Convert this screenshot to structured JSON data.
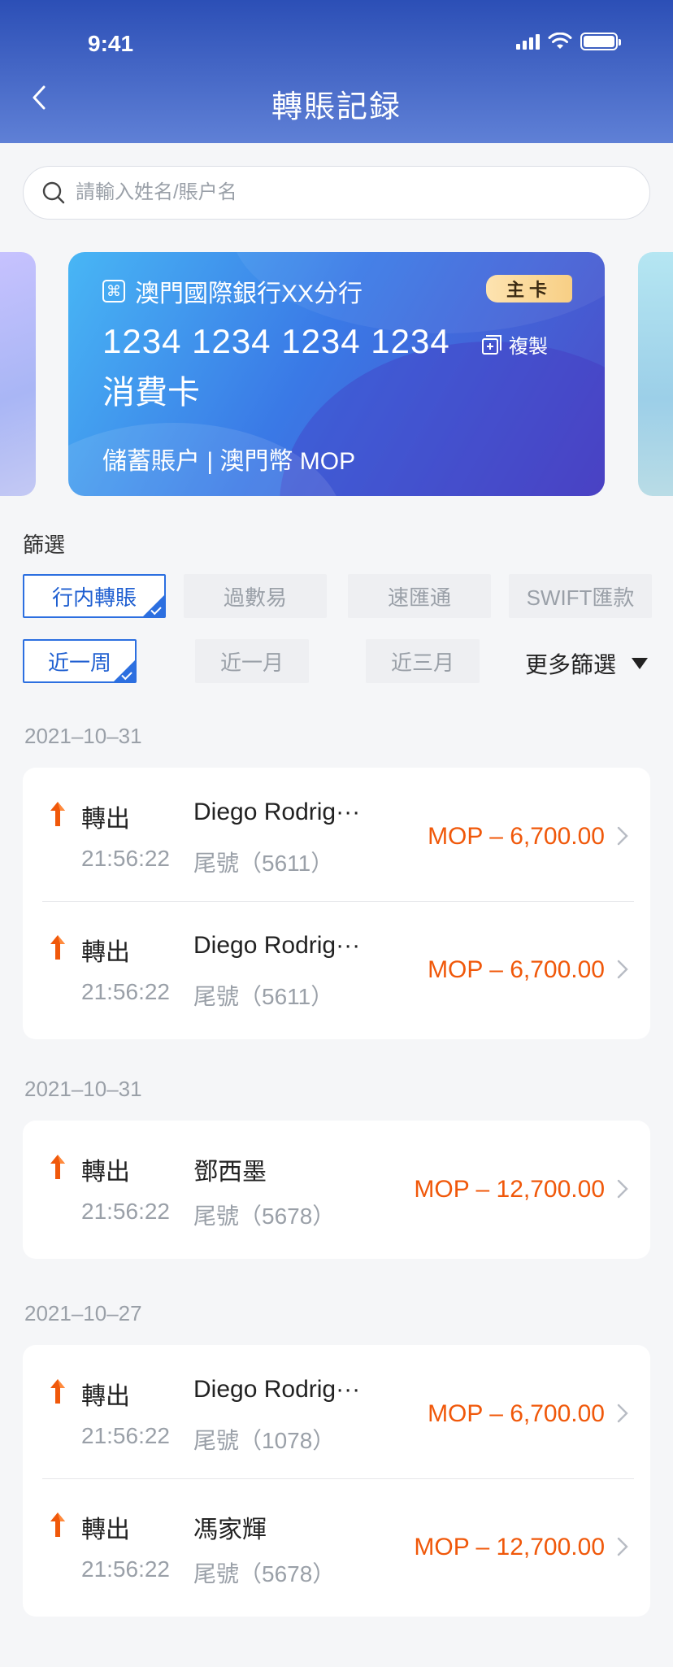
{
  "status_bar": {
    "time": "9:41"
  },
  "header": {
    "title": "轉賬記録"
  },
  "search": {
    "placeholder": "請輸入姓名/賬户名"
  },
  "card": {
    "bank_name": "澳門國際銀行XX分行",
    "badge": "主卡",
    "number": "1234 1234 1234 1234",
    "copy_label": "複製",
    "card_type": "消費卡",
    "account_info": "儲蓄賬户 | 澳門幣 MOP",
    "colors": {
      "start": "#48b6f5",
      "end": "#4d4bc7"
    }
  },
  "filter": {
    "title": "篩選",
    "types": [
      {
        "label": "行内轉賬",
        "active": true
      },
      {
        "label": "過數易",
        "active": false
      },
      {
        "label": "速匯通",
        "active": false
      },
      {
        "label": "SWIFT匯款",
        "active": false
      }
    ],
    "periods": [
      {
        "label": "近一周",
        "active": true
      },
      {
        "label": "近一月",
        "active": false
      },
      {
        "label": "近三月",
        "active": false
      }
    ],
    "more_label": "更多篩選",
    "accent_color": "#2c6fe0"
  },
  "groups": [
    {
      "date": "2021–10–31",
      "items": [
        {
          "type": "轉出",
          "name": "Diego Rodrig···",
          "time": "21:56:22",
          "tail": "尾號（5611）",
          "amount": "MOP – 6,700.00"
        },
        {
          "type": "轉出",
          "name": "Diego Rodrig···",
          "time": "21:56:22",
          "tail": "尾號（5611）",
          "amount": "MOP – 6,700.00"
        }
      ]
    },
    {
      "date": "2021–10–31",
      "items": [
        {
          "type": "轉出",
          "name": "鄧西墨",
          "time": "21:56:22",
          "tail": "尾號（5678）",
          "amount": "MOP – 12,700.00"
        }
      ]
    },
    {
      "date": "2021–10–27",
      "items": [
        {
          "type": "轉出",
          "name": "Diego Rodrig···",
          "time": "21:56:22",
          "tail": "尾號（1078）",
          "amount": "MOP – 6,700.00"
        },
        {
          "type": "轉出",
          "name": "馮家輝",
          "time": "21:56:22",
          "tail": "尾號（5678）",
          "amount": "MOP – 12,700.00"
        }
      ]
    }
  ],
  "amount_color": "#f0580a"
}
